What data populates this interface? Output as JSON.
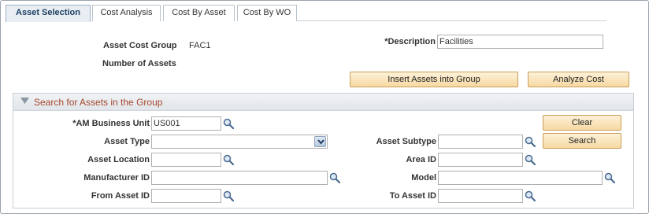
{
  "tabs": [
    {
      "label": "Asset Selection",
      "active": true
    },
    {
      "label": "Cost Analysis",
      "active": false
    },
    {
      "label": "Cost By Asset",
      "active": false
    },
    {
      "label": "Cost By WO",
      "active": false
    }
  ],
  "header": {
    "asset_cost_group_label": "Asset Cost Group",
    "asset_cost_group_value": "FAC1",
    "description_label": "*Description",
    "description_value": "Facilities",
    "number_of_assets_label": "Number of Assets",
    "number_of_assets_value": ""
  },
  "actions": {
    "insert_assets_label": "Insert Assets into Group",
    "analyze_cost_label": "Analyze Cost"
  },
  "search": {
    "title": "Search for Assets in the Group",
    "business_unit_label": "*AM Business Unit",
    "business_unit_value": "US001",
    "asset_type_label": "Asset Type",
    "asset_type_value": "",
    "asset_location_label": "Asset Location",
    "asset_location_value": "",
    "manufacturer_id_label": "Manufacturer ID",
    "manufacturer_id_value": "",
    "from_asset_id_label": "From Asset ID",
    "from_asset_id_value": "",
    "asset_subtype_label": "Asset Subtype",
    "asset_subtype_value": "",
    "area_id_label": "Area ID",
    "area_id_value": "",
    "model_label": "Model",
    "model_value": "",
    "to_asset_id_label": "To Asset ID",
    "to_asset_id_value": "",
    "clear_label": "Clear",
    "search_label": "Search"
  },
  "colors": {
    "tab_active_bg": "#e8eef4",
    "section_title": "#a7472e",
    "button_bg": "#f7d9a3"
  },
  "icons": {
    "lookup": "magnifier-icon",
    "section_toggle": "triangle-down-icon",
    "dropdown": "chevron-down-icon"
  }
}
